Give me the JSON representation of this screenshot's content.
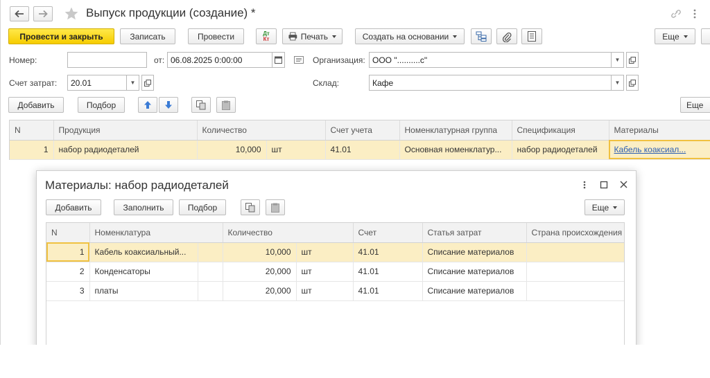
{
  "window": {
    "title": "Выпуск продукции (создание) *"
  },
  "toolbar": {
    "post_close": "Провести и закрыть",
    "save": "Записать",
    "post": "Провести",
    "dtkt_top": "Дт",
    "dtkt_bottom": "Кт",
    "print": "Печать",
    "create_based": "Создать на основании",
    "more": "Еще"
  },
  "form": {
    "number_label": "Номер:",
    "number_value": "",
    "date_label": "от:",
    "date_value": "06.08.2025  0:00:00",
    "org_label": "Организация:",
    "org_value": "ООО \"..........с\"",
    "cost_account_label": "Счет затрат:",
    "cost_account_value": "20.01",
    "warehouse_label": "Склад:",
    "warehouse_value": "Кафе"
  },
  "products_bar": {
    "add": "Добавить",
    "pick": "Подбор",
    "more": "Еще"
  },
  "products_table": {
    "columns": [
      "N",
      "Продукция",
      "Количество",
      "Счет учета",
      "Номенклатурная группа",
      "Спецификация",
      "Материалы"
    ],
    "rows": [
      {
        "n": "1",
        "product": "набор радиодеталей",
        "qty": "10,000",
        "unit": "шт",
        "account": "41.01",
        "group": "Основная номенклатур...",
        "spec": "набор радиодеталей",
        "materials": "Кабель коаксиал..."
      }
    ]
  },
  "dialog": {
    "title": "Материалы: набор радиодеталей",
    "add": "Добавить",
    "fill": "Заполнить",
    "pick": "Подбор",
    "more": "Еще",
    "columns": [
      "N",
      "Номенклатура",
      "Количество",
      "Счет",
      "Статья затрат",
      "Страна происхождения"
    ],
    "rows": [
      {
        "n": "1",
        "item": "Кабель коаксиальный...",
        "qty": "10,000",
        "unit": "шт",
        "account": "41.01",
        "cost_item": "Списание материалов",
        "country": ""
      },
      {
        "n": "2",
        "item": "Конденсаторы",
        "qty": "20,000",
        "unit": "шт",
        "account": "41.01",
        "cost_item": "Списание материалов",
        "country": ""
      },
      {
        "n": "3",
        "item": "платы",
        "qty": "20,000",
        "unit": "шт",
        "account": "41.01",
        "cost_item": "Списание материалов",
        "country": ""
      }
    ]
  },
  "colors": {
    "accent_yellow": "#f6cc00",
    "selected_row": "#fbeec4",
    "arrow_blue": "#3a7bd5",
    "link_blue": "#2b5eb3"
  }
}
